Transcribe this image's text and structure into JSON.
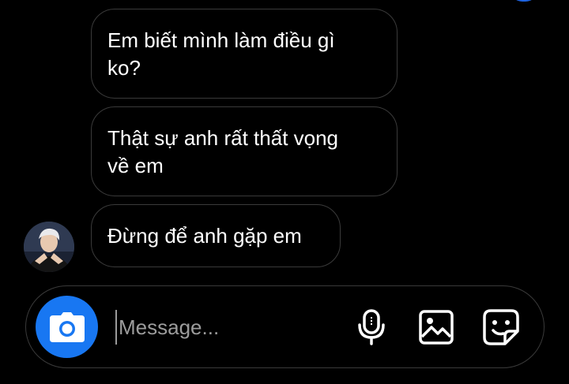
{
  "messages": [
    {
      "text_line1": "Em biết mình làm điều gì",
      "text_line2": "ko?"
    },
    {
      "text_line1": "Thật sự anh rất thất vọng",
      "text_line2": "về em"
    },
    {
      "text_line1": "Đừng để anh gặp em"
    }
  ],
  "composer": {
    "placeholder": "Message...",
    "camera_icon": "camera-icon",
    "mic_icon": "microphone-icon",
    "gallery_icon": "image-icon",
    "sticker_icon": "sticker-icon"
  },
  "colors": {
    "background": "#000000",
    "bubble_border": "#3a3a3a",
    "camera_button": "#1877f2",
    "placeholder": "#9c9c9c"
  }
}
